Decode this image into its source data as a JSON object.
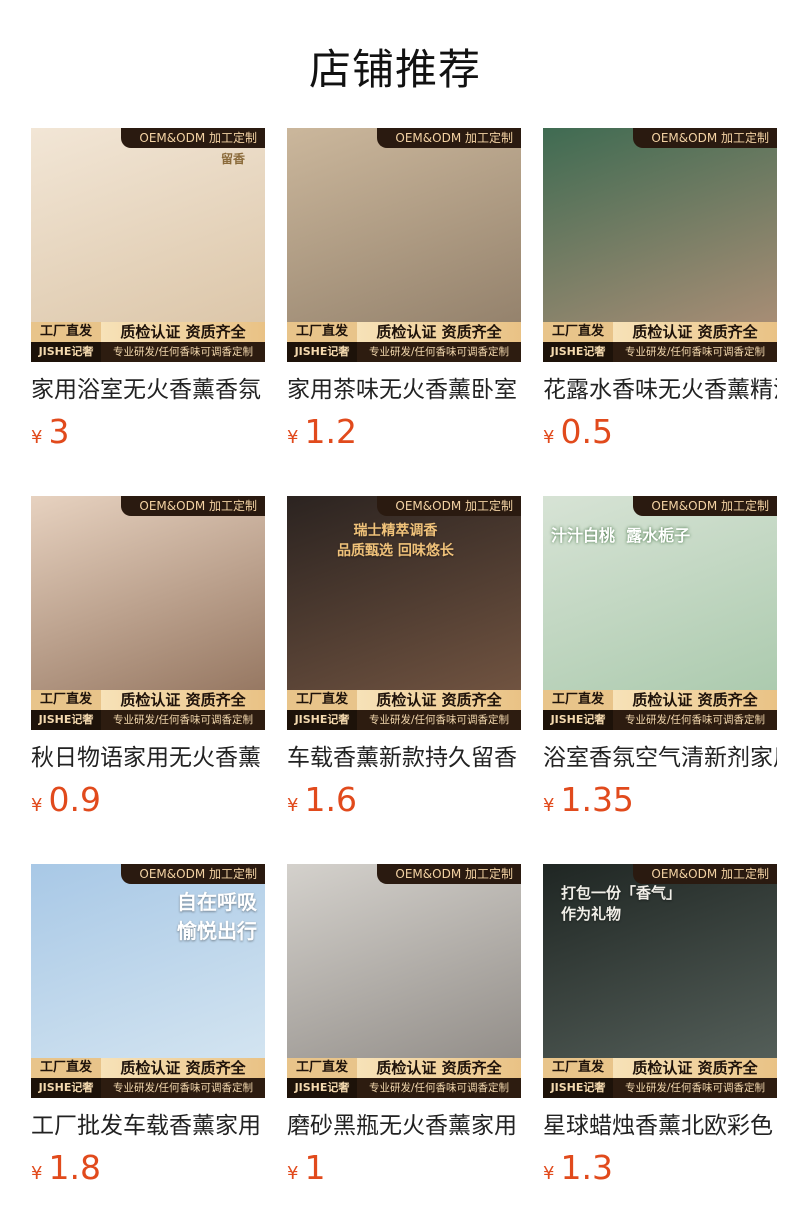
{
  "header": {
    "title": "店铺推荐"
  },
  "badge": {
    "oem": "OEM&ODM 加工定制",
    "factory": "工厂直发",
    "brand": "JISHE记奢",
    "quality": "质检认证 资质齐全",
    "service": "专业研发/任何香味可调香定制"
  },
  "currency": "¥",
  "products": [
    {
      "name": "家用浴室无火香薰香氛",
      "price": "3",
      "overlay": "留香",
      "colors": [
        "#f2e6d6",
        "#d9c2a3"
      ]
    },
    {
      "name": "家用茶味无火香薰卧室",
      "price": "1.2",
      "colors": [
        "#cbb79c",
        "#8d7b66"
      ]
    },
    {
      "name": "花露水香味无火香薰精油",
      "price": "0.5",
      "colors": [
        "#3f6b52",
        "#b6927a"
      ]
    },
    {
      "name": "秋日物语家用无火香薰",
      "price": "0.9",
      "colors": [
        "#e7d2c0",
        "#8b6b55"
      ]
    },
    {
      "name": "车载香薰新款持久留香",
      "price": "1.6",
      "overlay": "瑞士精萃调香\n品质甄选 回味悠长",
      "colors": [
        "#2b2320",
        "#7a5a45"
      ]
    },
    {
      "name": "浴室香氛空气清新剂家用",
      "price": "1.35",
      "overlay": "汁汁白桃  露水栀子",
      "colors": [
        "#d7e3d5",
        "#a6c7a9"
      ]
    },
    {
      "name": "工厂批发车载香薰家用",
      "price": "1.8",
      "overlay": "自在呼吸\n愉悦出行",
      "colors": [
        "#a8c8e6",
        "#d9e8f2"
      ]
    },
    {
      "name": "磨砂黑瓶无火香薰家用",
      "price": "1",
      "colors": [
        "#d4d1cc",
        "#8a8580"
      ]
    },
    {
      "name": "星球蜡烛香薰北欧彩色",
      "price": "1.3",
      "overlay": "打包一份「香气」\n作为礼物",
      "colors": [
        "#1f2623",
        "#5b6660"
      ]
    }
  ]
}
